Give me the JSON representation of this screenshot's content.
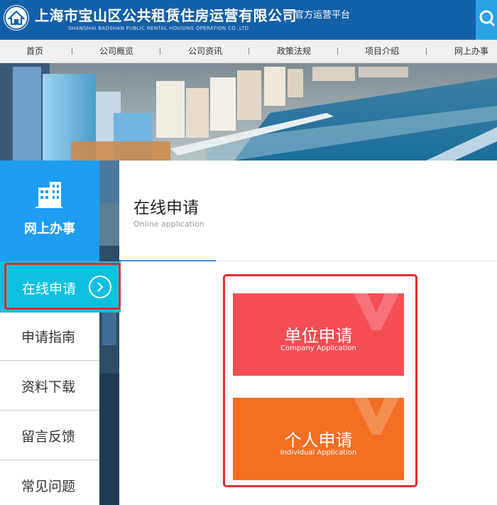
{
  "header": {
    "company_cn": "上海市宝山区公共租赁住房运营有限公司",
    "company_en": "SHANGHAI BAOSHAN PUBLIC RENTAL HOUSING OPERATION CO.,LTD",
    "platform": "官方运营平台",
    "logo_icon": "house-logo-icon",
    "search_icon": "search-icon"
  },
  "nav": {
    "items": [
      "首页",
      "公司概览",
      "公司资讯",
      "政策法规",
      "项目介绍",
      "网上办事"
    ]
  },
  "sidebar": {
    "title": "网上办事",
    "title_icon": "building-icon",
    "active": "在线申请",
    "items": [
      "申请指南",
      "资料下载",
      "留言反馈",
      "常见问题"
    ]
  },
  "main": {
    "title": "在线申请",
    "subtitle": "Online application"
  },
  "cards": [
    {
      "cn": "单位申请",
      "en": "Company Application",
      "color": "#f44e54"
    },
    {
      "cn": "个人申请",
      "en": "Individual Application",
      "color": "#f36f23"
    }
  ],
  "colors": {
    "header_blue": "#1460a8",
    "sidebar_blue": "#1f9df0",
    "active_cyan": "#0cc0e0",
    "highlight_red": "#e62c2c"
  }
}
